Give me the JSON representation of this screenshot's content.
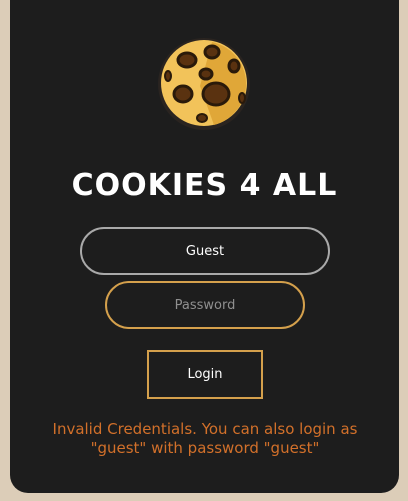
{
  "app": {
    "title": "COOKIES 4 ALL",
    "logo_icon": "cookie-icon"
  },
  "login_form": {
    "username_value": "Guest",
    "password_placeholder": "Password",
    "login_label": "Login"
  },
  "error": {
    "line1": "Invalid Credentials. You can also login as",
    "line2": "\"guest\" with password \"guest\""
  },
  "colors": {
    "background": "#dccdb8",
    "card": "#1d1d1d",
    "accent": "#d4a04c",
    "error": "#d2702a"
  }
}
